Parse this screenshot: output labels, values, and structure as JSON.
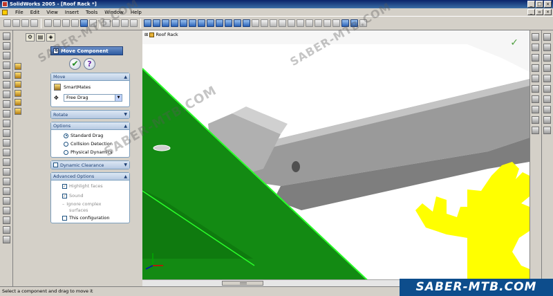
{
  "window": {
    "title": "SolidWorks 2005 - [Roof Rack *]",
    "minimize": "_",
    "maximize": "□",
    "close": "×"
  },
  "menu": [
    "File",
    "Edit",
    "View",
    "Insert",
    "Tools",
    "Window",
    "Help"
  ],
  "property_manager": {
    "title": "Move Component",
    "move_group": {
      "label": "Move",
      "smartmates": "SmartMates",
      "drag_mode": "Free Drag"
    },
    "rotate_group": {
      "label": "Rotate"
    },
    "options_group": {
      "label": "Options",
      "options": [
        "Standard Drag",
        "Collision Detection",
        "Physical Dynamics"
      ],
      "selected": "Standard Drag"
    },
    "dynamic_clearance": {
      "label": "Dynamic Clearance"
    },
    "advanced_group": {
      "label": "Advanced Options",
      "highlight_faces": "Highlight faces",
      "sound": "Sound",
      "ignore_complex_1": "Ignore complex",
      "ignore_complex_2": "surfaces",
      "this_configuration": "This configuration"
    }
  },
  "viewport": {
    "tree_label": "Roof Rack"
  },
  "status": "Select a component and drag to move it",
  "watermark": "SABER-MTB.COM",
  "colors": {
    "face_green": "#138a13",
    "edge_green": "#2aff2a",
    "logo_yellow": "#ffff00",
    "logo_blue": "#0d4d8c"
  }
}
